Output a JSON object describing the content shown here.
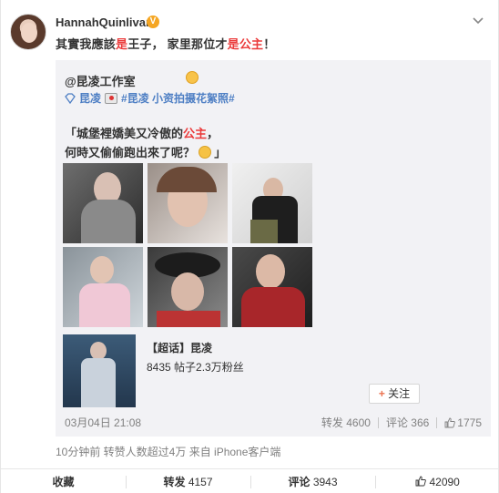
{
  "post": {
    "username": "HannahQuinlivan",
    "verified_badge": "V",
    "text_parts": [
      "其實我應該",
      "是",
      "王子， 家里那位才",
      "是公主",
      "！"
    ]
  },
  "repost": {
    "author": "@昆凌工作室",
    "tags": [
      "昆凌",
      "#昆凌 小资拍摄花絮照#"
    ],
    "quote_line1_a": "「城堡裡嬌美又冷傲的",
    "quote_line1_b": "公主",
    "quote_line1_c": "，",
    "quote_line2": "何時又偷偷跑出來了呢？",
    "quote_end": "」",
    "super_title": "【超话】昆凌",
    "super_sub": "8435 帖子2.3万粉丝",
    "follow_label": "关注",
    "time": "03月04日 21:08",
    "stats": {
      "forward": "转发 4600",
      "comment": "评论 366",
      "likes": "1775"
    }
  },
  "meta": "10分钟前 转赞人数超过4万 来自 iPhone客户端",
  "footer": {
    "collect": "收藏",
    "forward_label": "转发",
    "forward_count": "4157",
    "comment_label": "评论",
    "comment_count": "3943",
    "like_count": "42090"
  },
  "colors": {
    "accent_red": "#eb3a3a",
    "link_blue": "#4e7fc4",
    "muted": "#808080"
  }
}
